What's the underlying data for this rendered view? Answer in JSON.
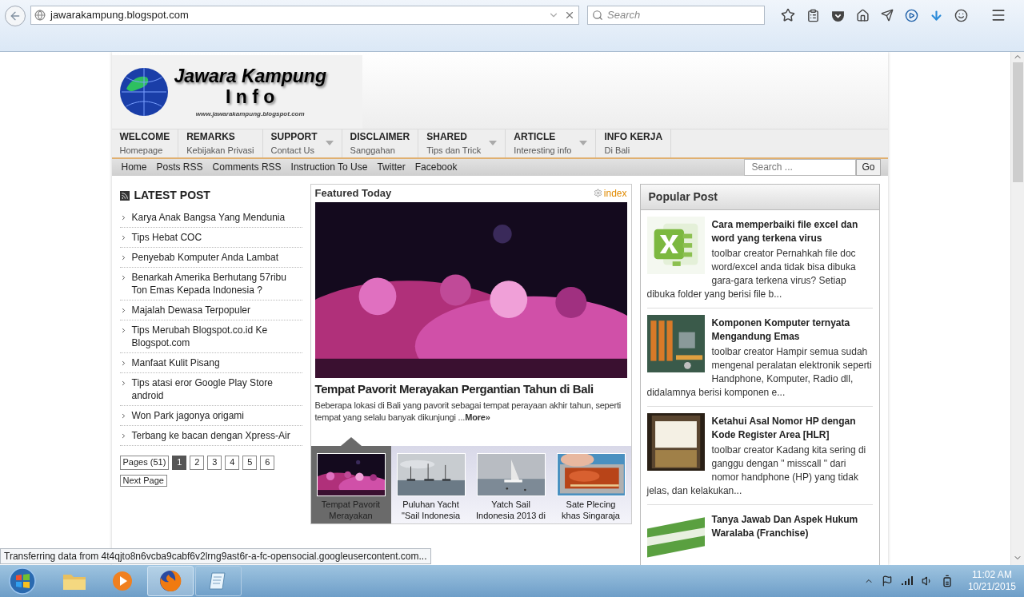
{
  "browser": {
    "url": "jawarakampung.blogspot.com",
    "search_placeholder": "Search"
  },
  "logo": {
    "line1": "Jawara Kampung",
    "line2": "I n f o",
    "url": "www.jawarakampung.blogspot.com"
  },
  "nav": [
    {
      "title": "WELCOME",
      "subtitle": "Homepage",
      "dropdown": false
    },
    {
      "title": "REMARKS",
      "subtitle": "Kebijakan Privasi",
      "dropdown": false
    },
    {
      "title": "SUPPORT",
      "subtitle": "Contact Us",
      "dropdown": true
    },
    {
      "title": "DISCLAIMER",
      "subtitle": "Sanggahan",
      "dropdown": false
    },
    {
      "title": "SHARED",
      "subtitle": "Tips dan Trick",
      "dropdown": true
    },
    {
      "title": "ARTICLE",
      "subtitle": "Interesting info",
      "dropdown": true
    },
    {
      "title": "INFO KERJA",
      "subtitle": "Di Bali",
      "dropdown": false
    }
  ],
  "subnav": {
    "links": [
      "Home",
      "Posts RSS",
      "Comments RSS",
      "Instruction To Use",
      "Twitter",
      "Facebook"
    ],
    "search_placeholder": "Search ...",
    "button": "Go"
  },
  "latest_post": {
    "title": "LATEST POST",
    "items": [
      "Karya Anak Bangsa Yang Mendunia",
      "Tips Hebat COC",
      "Penyebab Komputer Anda Lambat",
      "Benarkah Amerika Berhutang 57ribu Ton Emas Kepada Indonesia ?",
      "Majalah Dewasa Terpopuler",
      "Tips Merubah Blogspot.co.id Ke Blogspot.com",
      "Manfaat Kulit Pisang",
      "Tips atasi eror Google Play Store android",
      "Won Park jagonya origami",
      "Terbang ke bacan dengan Xpress-Air"
    ],
    "pages_label": "Pages (51)",
    "pages": [
      {
        "label": "1",
        "selected": true
      },
      {
        "label": "2",
        "selected": false
      },
      {
        "label": "3",
        "selected": false
      },
      {
        "label": "4",
        "selected": false
      },
      {
        "label": "5",
        "selected": false
      },
      {
        "label": "6",
        "selected": false
      }
    ],
    "next": "Next Page"
  },
  "featured": {
    "title": "Featured Today",
    "index_link": "index",
    "headline": "Tempat Pavorit Merayakan Pergantian Tahun di Bali",
    "summary": "Beberapa lokasi di Bali yang pavorit sebagai tempat perayaan akhir tahun, seperti tempat yang selalu banyak dikunjungi ...",
    "more": "More»",
    "thumbs": [
      {
        "caption": "Tempat Pavorit Merayakan",
        "selected": true
      },
      {
        "caption": "Puluhan Yacht \"Sail Indonesia",
        "selected": false
      },
      {
        "caption": "Yatch Sail Indonesia 2013 di",
        "selected": false
      },
      {
        "caption": "Sate Plecing khas Singaraja",
        "selected": false
      }
    ]
  },
  "popular": {
    "title": "Popular Post",
    "posts": [
      {
        "title": "Cara memperbaiki file excel dan word yang terkena virus",
        "excerpt": "toolbar creator Pernahkah file doc word/excel anda tidak bisa dibuka gara-gara terkena virus? Setiap dibuka folder yang berisi file b..."
      },
      {
        "title": "Komponen Komputer ternyata Mengandung Emas",
        "excerpt": "toolbar creator Hampir semua sudah mengenal  peralatan elektronik seperti Handphone, Komputer, Radio dll, didalamnya berisi komponen e..."
      },
      {
        "title": "Ketahui Asal Nomor HP dengan Kode Register Area [HLR]",
        "excerpt": "toolbar creator Kadang kita sering di ganggu dengan \" misscall \" dari nomor handphone (HP) yang tidak jelas, dan kelakukan..."
      },
      {
        "title": "Tanya Jawab Dan Aspek Hukum Waralaba (Franchise)"
      }
    ]
  },
  "status_text": "Transferring data from 4t4qjto8n6vcba9cabf6v2lrng9ast6r-a-fc-opensocial.googleusercontent.com...",
  "taskbar": {
    "time": "11:02 AM",
    "date": "10/21/2015"
  }
}
